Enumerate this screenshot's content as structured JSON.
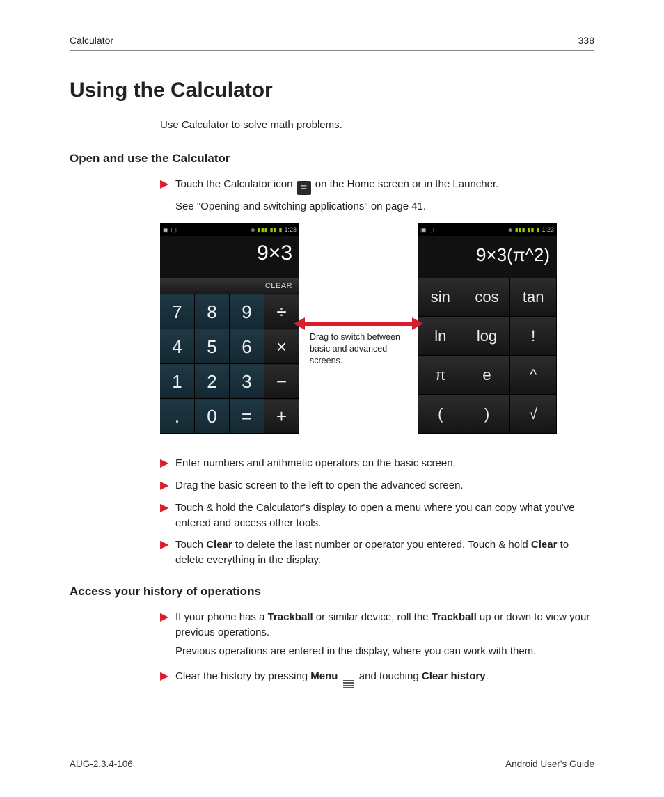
{
  "header": {
    "left": "Calculator",
    "right": "338"
  },
  "title": "Using the Calculator",
  "intro": "Use Calculator to solve math problems.",
  "section1": {
    "heading": "Open and use the Calculator",
    "step1_pre": "Touch the Calculator icon ",
    "step1_post": " on the Home screen or in the Launcher.",
    "see": "See \"Opening and switching applications\" on page 41.",
    "step2": "Enter numbers and arithmetic operators on the basic screen.",
    "step3": "Drag the basic screen to the left to open the advanced screen.",
    "step4": "Touch & hold the Calculator's display to open a menu where you can copy what you've entered and access other tools.",
    "step5_a": "Touch ",
    "step5_b": "Clear",
    "step5_c": " to delete the last number or operator you entered. Touch & hold ",
    "step5_d": "Clear",
    "step5_e": " to delete everything in the display."
  },
  "shots": {
    "status_time": "1:23",
    "basic_display": "9×3",
    "adv_display": "9×3(π^2)",
    "clear_label": "CLEAR",
    "basic_keys": [
      "7",
      "8",
      "9",
      "÷",
      "4",
      "5",
      "6",
      "×",
      "1",
      "2",
      "3",
      "−",
      ".",
      "0",
      "=",
      "+"
    ],
    "basic_ops_idx": [
      3,
      7,
      11,
      15
    ],
    "adv_keys": [
      "sin",
      "cos",
      "tan",
      "ln",
      "log",
      "!",
      "π",
      "e",
      "^",
      "(",
      ")",
      "√"
    ],
    "drag_note": "Drag to switch between basic and advanced screens."
  },
  "section2": {
    "heading": "Access your history of operations",
    "step1_a": "If your phone has a ",
    "step1_b": "Trackball",
    "step1_c": " or similar device, roll the ",
    "step1_d": "Trackball",
    "step1_e": " up or down to view your previous operations.",
    "prev": "Previous operations are entered in the display, where you can work with them.",
    "step2_a": "Clear the history by pressing ",
    "step2_b": "Menu",
    "step2_c": " and touching ",
    "step2_d": "Clear history",
    "step2_e": "."
  },
  "footer": {
    "left": "AUG-2.3.4-106",
    "right": "Android User's Guide"
  }
}
